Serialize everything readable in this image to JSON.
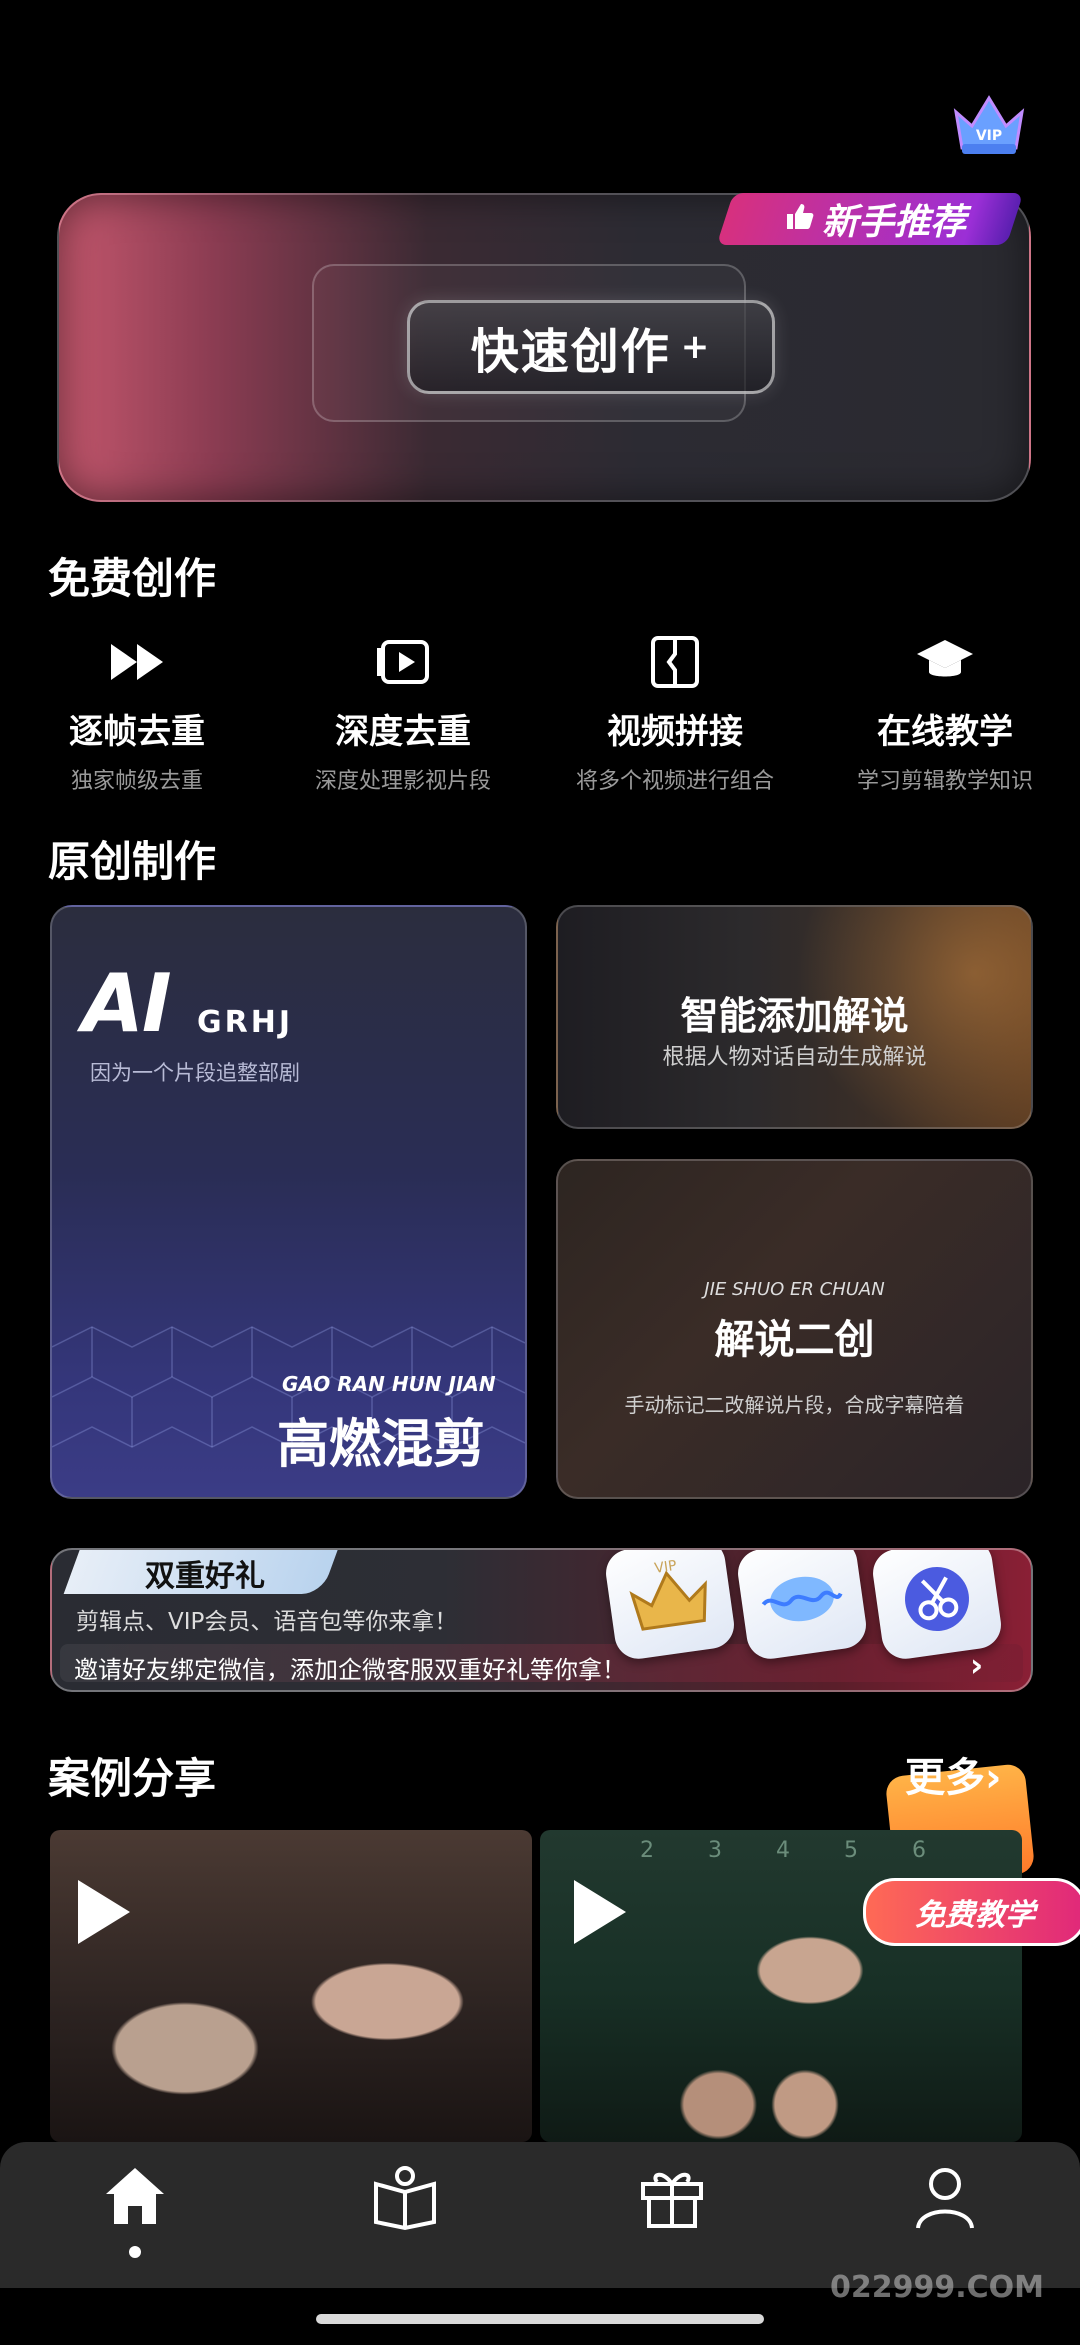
{
  "hero": {
    "badge": "新手推荐",
    "button_label": "快速创作",
    "button_plus": "+"
  },
  "free_section": {
    "title": "免费创作",
    "tools": [
      {
        "title": "逐帧去重",
        "subtitle": "独家帧级去重",
        "icon": "fast-forward-icon"
      },
      {
        "title": "深度去重",
        "subtitle": "深度处理影视片段",
        "icon": "video-play-icon"
      },
      {
        "title": "视频拼接",
        "subtitle": "将多个视频进行组合",
        "icon": "splice-icon"
      },
      {
        "title": "在线教学",
        "subtitle": "学习剪辑教学知识",
        "icon": "graduation-cap-icon"
      }
    ]
  },
  "original_section": {
    "title": "原创制作",
    "ai_card": {
      "logo_ai": "AI",
      "logo_suffix": "GRHJ",
      "tagline": "因为一个片段追整部剧",
      "pinyin": "GAO RAN HUN JIAN",
      "title": "高燃混剪"
    },
    "smart_card": {
      "title": "智能添加解说",
      "subtitle": "根据人物对话自动生成解说"
    },
    "recreate_card": {
      "pinyin": "JIE SHUO ER CHUAN",
      "title": "解说二创",
      "subtitle": "手动标记二改解说片段，合成字幕陪着"
    }
  },
  "gift_banner": {
    "tab": "双重好礼",
    "line1": "剪辑点、VIP会员、语音包等你来拿！",
    "line2": "邀请好友绑定微信，添加企微客服双重好礼等你拿！",
    "arrow": "›",
    "vip_text": "VIP"
  },
  "cases_section": {
    "title": "案例分享",
    "more": "更多",
    "more_arrow": "›",
    "free_teach_badge": "免费教学",
    "numbers": "23456"
  },
  "bottom_nav": {
    "items": [
      {
        "name": "home",
        "icon": "home-icon"
      },
      {
        "name": "learn",
        "icon": "book-icon"
      },
      {
        "name": "gift",
        "icon": "gift-icon"
      },
      {
        "name": "profile",
        "icon": "user-icon"
      }
    ]
  },
  "watermark": "022999.COM",
  "colors": {
    "background": "#000000",
    "hero_gradient_start": "#c4576d",
    "badge_pink": "#d7307e",
    "badge_purple": "#9b2fd6",
    "nav_bg": "#2a2a2a"
  }
}
